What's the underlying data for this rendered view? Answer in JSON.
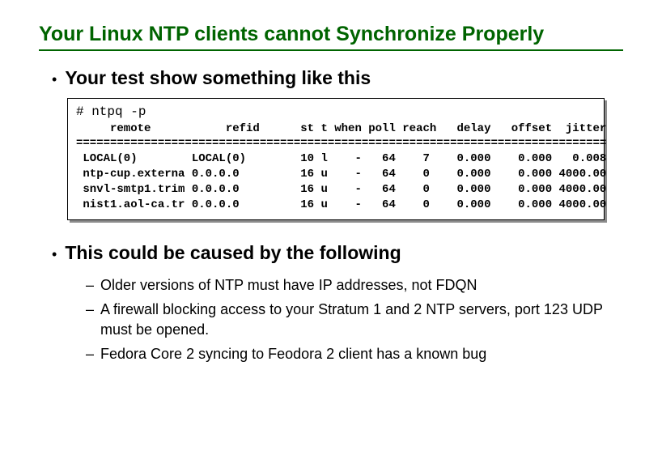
{
  "title": "Your Linux NTP clients cannot Synchronize Properly",
  "bullets": {
    "b1": "Your test show something like this",
    "b2": "This could be caused by the following"
  },
  "term": {
    "cmd": "# ntpq -p",
    "header": "     remote           refid      st t when poll reach   delay   offset  jitter",
    "sep": "==============================================================================",
    "r0": " LOCAL(0)        LOCAL(0)        10 l    -   64    7    0.000    0.000   0.008",
    "r1": " ntp-cup.externa 0.0.0.0         16 u    -   64    0    0.000    0.000 4000.00",
    "r2": " snvl-smtp1.trim 0.0.0.0         16 u    -   64    0    0.000    0.000 4000.00",
    "r3": " nist1.aol-ca.tr 0.0.0.0         16 u    -   64    0    0.000    0.000 4000.00"
  },
  "subs": {
    "s1": "Older versions of NTP must have IP addresses, not FDQN",
    "s2": "A firewall blocking access to your Stratum 1 and 2 NTP servers, port 123 UDP must be opened.",
    "s3": "Fedora Core 2 syncing to Feodora 2 client has a known bug"
  }
}
